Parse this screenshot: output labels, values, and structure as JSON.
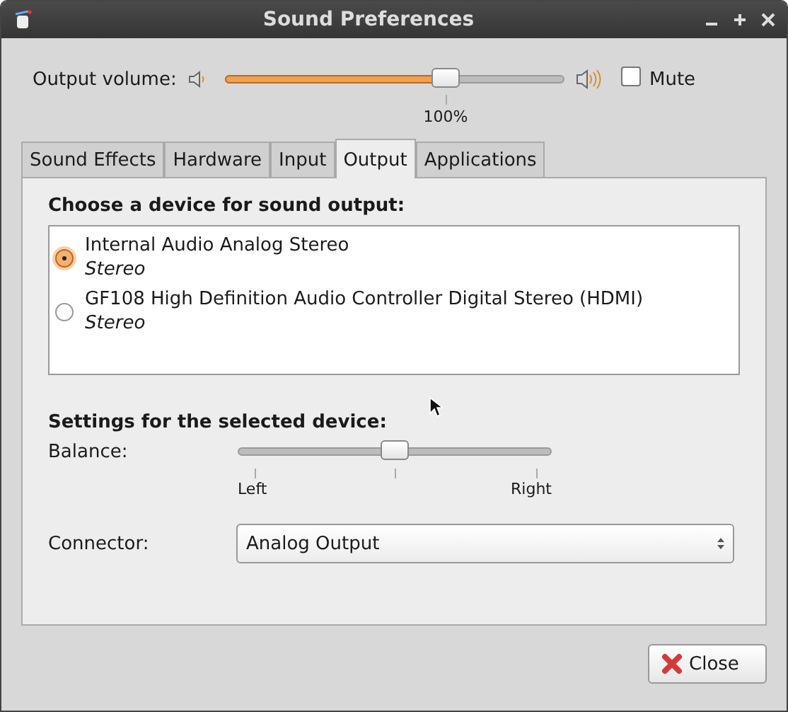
{
  "window": {
    "title": "Sound Preferences"
  },
  "output_volume": {
    "label": "Output volume:",
    "level": 0.65,
    "reading": "100%",
    "mute": {
      "label": "Mute",
      "checked": false
    }
  },
  "tabs": [
    {
      "label": "Sound Effects",
      "selected": false
    },
    {
      "label": "Hardware",
      "selected": false
    },
    {
      "label": "Input",
      "selected": false
    },
    {
      "label": "Output",
      "selected": true
    },
    {
      "label": "Applications",
      "selected": false
    }
  ],
  "device_heading": "Choose a device for sound output:",
  "devices": [
    {
      "name": "Internal Audio Analog Stereo",
      "profile": "Stereo",
      "selected": true
    },
    {
      "name": "GF108 High Definition Audio Controller Digital Stereo (HDMI)",
      "profile": "Stereo",
      "selected": false
    }
  ],
  "settings_heading": "Settings for the selected device:",
  "balance": {
    "label": "Balance:",
    "level": 0.5,
    "left": "Left",
    "right": "Right"
  },
  "connector": {
    "label": "Connector:",
    "value": "Analog Output"
  },
  "buttons": [
    {
      "label": "Close"
    }
  ]
}
